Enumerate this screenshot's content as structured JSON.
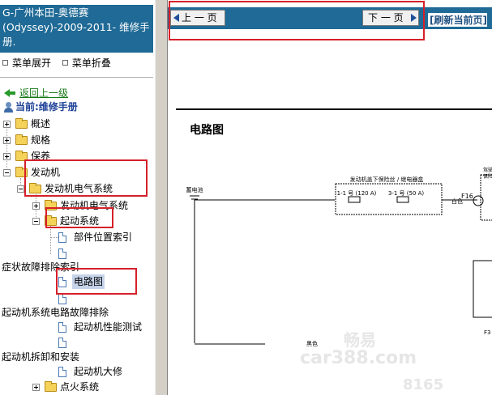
{
  "left_pane": {
    "book_title": "G-广州本田-奥德赛(Odyssey)-2009-2011- 维修手册.",
    "menu_expand": "菜单展开",
    "menu_collapse": "菜单折叠",
    "back_link": "返回上一级",
    "current_label": "当前:维修手册",
    "tree": [
      {
        "label": "概述",
        "state": "collapsed"
      },
      {
        "label": "规格",
        "state": "collapsed"
      },
      {
        "label": "保养",
        "state": "collapsed"
      },
      {
        "label": "发动机",
        "state": "expanded"
      },
      {
        "label": "发动机电气系统",
        "state": "expanded"
      },
      {
        "label": "发动机电气系统",
        "state": "collapsed"
      },
      {
        "label": "起动系统",
        "state": "expanded"
      },
      {
        "label": "部件位置索引",
        "state": "leaf"
      },
      {
        "label": "",
        "state": "leaf"
      },
      {
        "label": "症状故障排除索引",
        "state": "group"
      },
      {
        "label": "电路图",
        "state": "selected"
      },
      {
        "label": "",
        "state": "leaf"
      },
      {
        "label": "起动机系统电路故障排除",
        "state": "group"
      },
      {
        "label": "起动机性能测试",
        "state": "leaf"
      },
      {
        "label": "",
        "state": "leaf"
      },
      {
        "label": "起动机拆卸和安装",
        "state": "group"
      },
      {
        "label": "起动机大修",
        "state": "leaf"
      },
      {
        "label": "点火系统",
        "state": "collapsed"
      }
    ]
  },
  "toolbar": {
    "prev_label": "上 一 页",
    "next_label": "下 一 页",
    "refresh_label": "[刷新当前页]"
  },
  "document": {
    "heading": "电路图",
    "diagram": {
      "battery_label": "蓄电池",
      "fuse_box_label": "发动机盖下保险丝 / 继电器盒",
      "fuse1": "1-1 号 (120 A)",
      "fuse2": "3-1 号 (50 A)",
      "wire_white": "白色",
      "connector": "F16",
      "right_box_label_1": "驾驶",
      "right_box_label_2": "保险",
      "ground_wire": "黑色",
      "f3_label": "F3"
    },
    "watermark_1": "畅易",
    "watermark_2": "car388.com",
    "watermark_3": "8165"
  },
  "colors": {
    "header_bg": "#1f6a96",
    "highlight_box": "#d6202a",
    "selected_bg": "#c6d4ea"
  }
}
